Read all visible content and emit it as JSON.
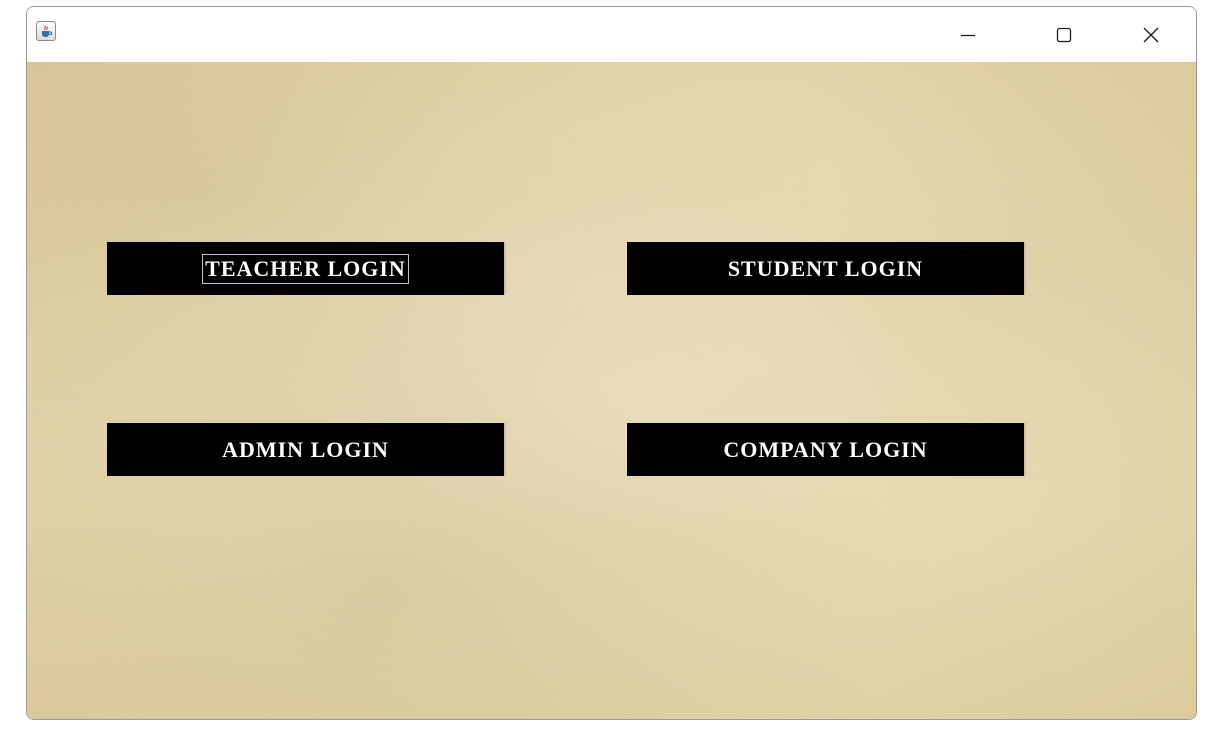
{
  "window": {
    "title": ""
  },
  "titlebar": {
    "app_icon": "java-cup-icon",
    "controls": [
      "minimize-icon",
      "maximize-icon",
      "close-icon"
    ]
  },
  "buttons": {
    "teacher": "TEACHER LOGIN",
    "student": "STUDENT LOGIN",
    "admin": "ADMIN LOGIN",
    "company": "COMPANY LOGIN"
  },
  "colors": {
    "button_bg": "#000000",
    "button_text": "#ffffff",
    "background_parchment": "#e9dcb6"
  }
}
